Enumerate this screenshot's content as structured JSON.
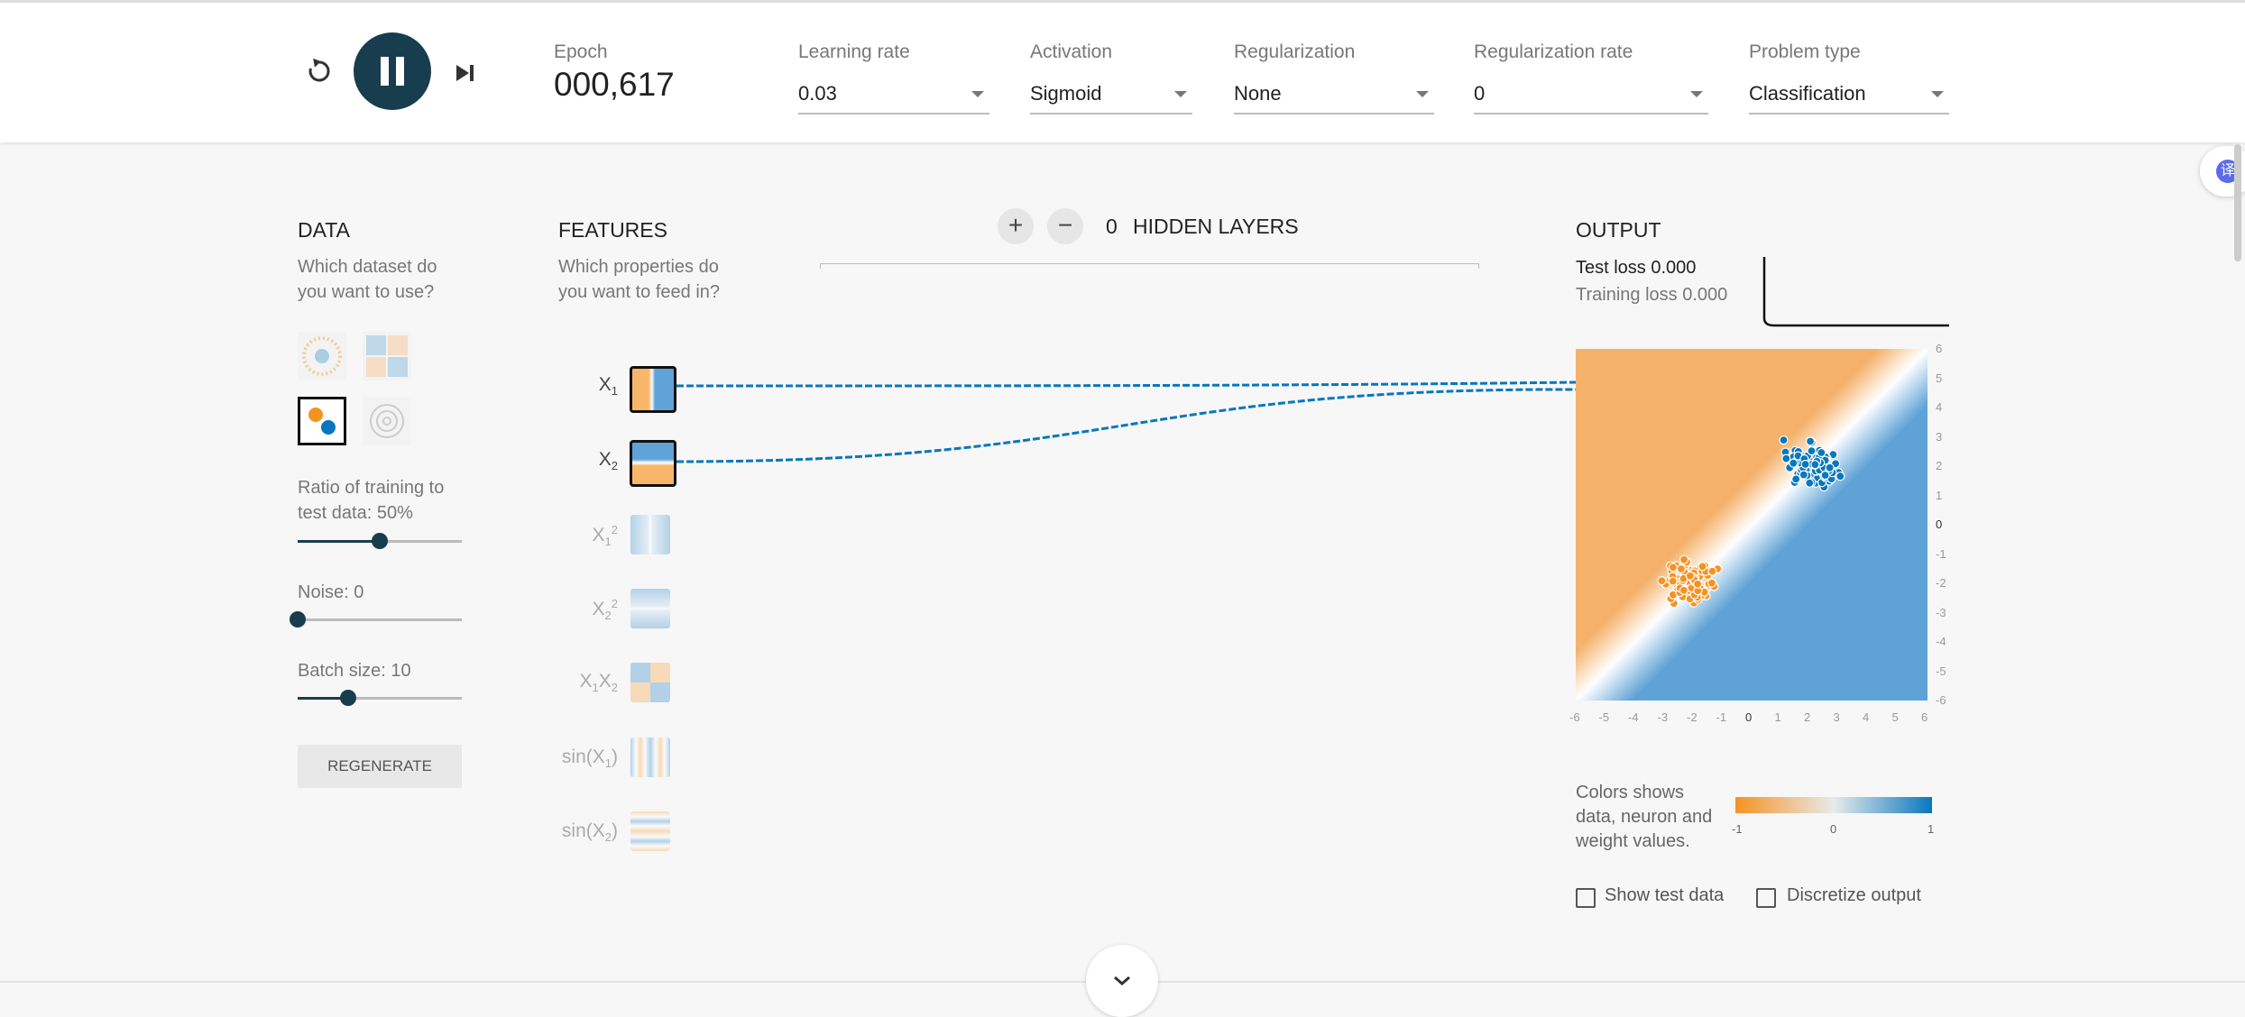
{
  "controls": {
    "epoch_label": "Epoch",
    "epoch_value": "000,617",
    "learning_rate": {
      "label": "Learning rate",
      "value": "0.03"
    },
    "activation": {
      "label": "Activation",
      "value": "Sigmoid"
    },
    "regularization": {
      "label": "Regularization",
      "value": "None"
    },
    "regularization_rate": {
      "label": "Regularization rate",
      "value": "0"
    },
    "problem_type": {
      "label": "Problem type",
      "value": "Classification"
    }
  },
  "data_panel": {
    "title": "DATA",
    "subtitle_line1": "Which dataset do",
    "subtitle_line2": "you want to use?",
    "ratio_label_line1": "Ratio of training to",
    "ratio_label_line2": "test data:  50%",
    "ratio_value": 50,
    "noise_label": "Noise:  0",
    "noise_value": 0,
    "batch_label": "Batch size:  10",
    "batch_value": 10,
    "regenerate": "REGENERATE"
  },
  "features_panel": {
    "title": "FEATURES",
    "subtitle_line1": "Which properties do",
    "subtitle_line2": "you want to feed in?",
    "features": [
      {
        "base": "X",
        "sub": "1",
        "sup": ""
      },
      {
        "base": "X",
        "sub": "2",
        "sup": ""
      },
      {
        "base": "X",
        "sub": "1",
        "sup": "2"
      },
      {
        "base": "X",
        "sub": "2",
        "sup": "2"
      },
      {
        "base": "X",
        "sub": "1",
        "base2": "X",
        "sub2": "2"
      },
      {
        "text_pre": "sin(X",
        "sub": "1",
        "text_post": ")"
      },
      {
        "text_pre": "sin(X",
        "sub": "2",
        "text_post": ")"
      }
    ]
  },
  "layers": {
    "add": "+",
    "remove": "−",
    "count": "0",
    "label": "HIDDEN LAYERS"
  },
  "output_panel": {
    "title": "OUTPUT",
    "test_loss": "Test loss 0.000",
    "training_loss": "Training loss 0.000",
    "y_ticks": [
      "6",
      "5",
      "4",
      "3",
      "2",
      "1",
      "0",
      "-1",
      "-2",
      "-3",
      "-4",
      "-5",
      "-6"
    ],
    "x_ticks": [
      "-6",
      "-5",
      "-4",
      "-3",
      "-2",
      "-1",
      "0",
      "1",
      "2",
      "3",
      "4",
      "5",
      "6"
    ],
    "legend_line1": "Colors shows",
    "legend_line2": "data, neuron and",
    "legend_line3": "weight values.",
    "scale_min": "-1",
    "scale_mid": "0",
    "scale_max": "1",
    "show_test_data": "Show test data",
    "discretize_output": "Discretize output"
  },
  "colors": {
    "orange": "#f59322",
    "blue": "#0877bd",
    "dark_button": "#183d4e"
  },
  "icons": {
    "reset": "reset-icon",
    "pause": "pause-icon",
    "step": "step-icon",
    "translate": "translate-icon",
    "expand": "chevron-down-icon"
  }
}
